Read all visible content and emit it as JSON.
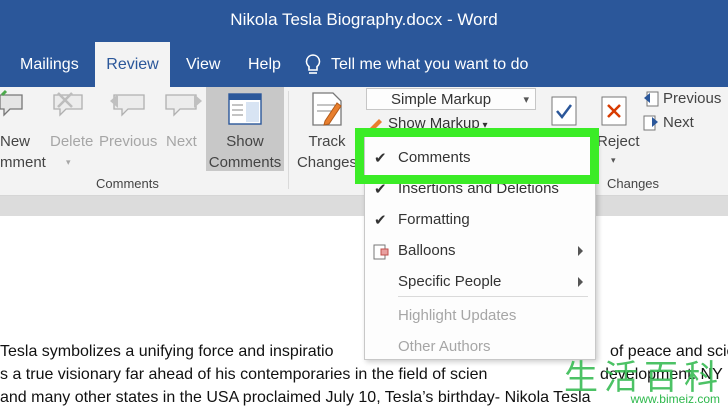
{
  "window": {
    "title": "Nikola Tesla Biography.docx  -  Word"
  },
  "tabs": [
    {
      "label": "Mailings"
    },
    {
      "label": "Review"
    },
    {
      "label": "View"
    },
    {
      "label": "Help"
    }
  ],
  "tell_me": "Tell me what you want to do",
  "ribbon": {
    "new_comment": [
      "New",
      "mment"
    ],
    "delete": "Delete",
    "previous": "Previous",
    "next": "Next",
    "show_comments": [
      "Show",
      "Comments"
    ],
    "comments_group": "Comments",
    "track_changes": [
      "Track",
      "Changes"
    ],
    "markup_combo": "Simple Markup",
    "show_markup": "Show Markup",
    "reject": "Reject",
    "changes_previous": "Previous",
    "changes_next": "Next",
    "changes_group": "Changes"
  },
  "show_markup_menu": [
    {
      "label": "Comments",
      "checked": true
    },
    {
      "label": "Insertions and Deletions",
      "checked": true
    },
    {
      "label": "Formatting",
      "checked": true
    },
    {
      "label": "Balloons",
      "submenu": true
    },
    {
      "label": "Specific People",
      "submenu": true
    },
    {
      "label": "Highlight Updates",
      "disabled": true
    },
    {
      "label": "Other Authors",
      "disabled": true
    }
  ],
  "document": {
    "lines": [
      " Tesla symbolizes a unifying force and inspiratio",
      "s a true visionary far ahead of his contemporaries in the field of scien",
      "and many other states in the USA proclaimed July 10, Tesla’s birthday- Nikola Tesla"
    ],
    "line1_tail": "of peace and scien",
    "line2_tail": "development. NY"
  },
  "watermark": {
    "chars": "生活百科",
    "url": "www.bimeiz.com"
  },
  "colors": {
    "accent": "#2b579a",
    "highlight": "#3bec26"
  }
}
